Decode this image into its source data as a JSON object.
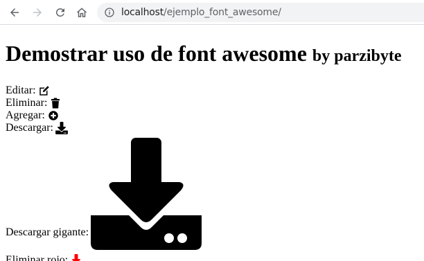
{
  "browser": {
    "url_host": "localhost",
    "url_path": "/ejemplo_font_awesome/",
    "icons": {
      "back": "arrow-left-icon",
      "forward": "arrow-right-icon",
      "reload": "reload-icon",
      "home": "home-icon",
      "info": "info-icon"
    }
  },
  "page": {
    "title_main": "Demostrar uso de font awesome",
    "title_small": "by parzibyte",
    "items": [
      {
        "label": "Editar:",
        "icon": "edit-icon"
      },
      {
        "label": "Eliminar:",
        "icon": "trash-icon"
      },
      {
        "label": "Agregar:",
        "icon": "plus-circle-icon"
      },
      {
        "label": "Descargar:",
        "icon": "download-icon"
      }
    ],
    "big_item": {
      "label": "Descargar gigante:",
      "icon": "download-icon"
    },
    "red_item": {
      "label": "Eliminar rojo:",
      "icon": "download-icon",
      "color": "#ff0000"
    }
  },
  "colors": {
    "nav_active": "#5f6368",
    "nav_disabled": "#bdc1c6",
    "omnibox_bg": "#f1f3f4",
    "red": "#ff0000"
  }
}
